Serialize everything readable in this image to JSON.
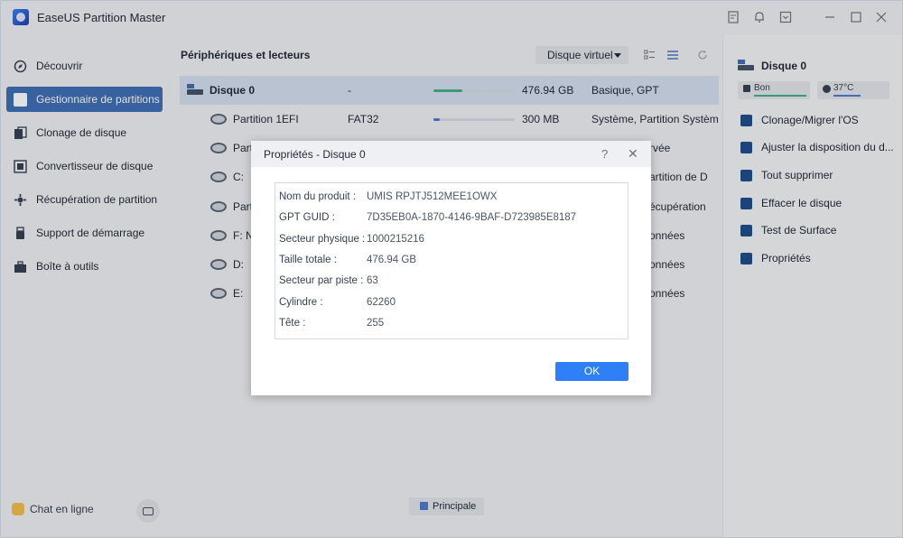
{
  "app": {
    "title": "EaseUS Partition Master"
  },
  "titlebar_icons": [
    "notes-icon",
    "bell-icon",
    "dropdown-box-icon",
    "minimize-icon",
    "maximize-icon",
    "close-icon"
  ],
  "sidebar": {
    "items": [
      {
        "label": "Découvrir",
        "icon": "compass-icon",
        "active": false
      },
      {
        "label": "Gestionnaire de partitions",
        "icon": "partition-manager-icon",
        "active": true
      },
      {
        "label": "Clonage de disque",
        "icon": "clone-icon",
        "active": false
      },
      {
        "label": "Convertisseur de disque",
        "icon": "convert-icon",
        "active": false
      },
      {
        "label": "Récupération de partition",
        "icon": "recovery-icon",
        "active": false
      },
      {
        "label": "Support de démarrage",
        "icon": "usb-icon",
        "active": false
      },
      {
        "label": "Boîte à outils",
        "icon": "toolbox-icon",
        "active": false
      }
    ],
    "chat_label": "Chat en ligne"
  },
  "main": {
    "title": "Périphériques et lecteurs",
    "virtual_disk_label": "Disque virtuel",
    "rows": [
      {
        "name": "Disque 0",
        "fs": "-",
        "size": "476.94 GB",
        "type": "Basique, GPT",
        "usage": 0.35,
        "kind": "disk"
      },
      {
        "name": "Partition 1EFI",
        "fs": "FAT32",
        "size": "300 MB",
        "type": "Système, Partition Système",
        "usage": 0.08,
        "kind": "part"
      },
      {
        "name": "Parti",
        "fs": "",
        "size": "",
        "type": "rvée",
        "usage": null,
        "kind": "part"
      },
      {
        "name": "C:",
        "fs": "",
        "size": "",
        "type": "artition de D",
        "usage": null,
        "kind": "part"
      },
      {
        "name": "Parti",
        "fs": "",
        "size": "",
        "type": "écupération",
        "usage": null,
        "kind": "part"
      },
      {
        "name": "F: Ne",
        "fs": "",
        "size": "",
        "type": "onnées",
        "usage": null,
        "kind": "part"
      },
      {
        "name": "D:",
        "fs": "",
        "size": "",
        "type": "onnées",
        "usage": null,
        "kind": "part"
      },
      {
        "name": "E:",
        "fs": "",
        "size": "",
        "type": "onnées",
        "usage": null,
        "kind": "part"
      }
    ],
    "legend_label": "Principale"
  },
  "right_panel": {
    "disk_name": "Disque 0",
    "health_label": "Bon",
    "temp_label": "37°C",
    "actions": [
      {
        "label": "Clonage/Migrer l'OS",
        "icon": "windows-icon"
      },
      {
        "label": "Ajuster la disposition du d...",
        "icon": "layout-icon"
      },
      {
        "label": "Tout supprimer",
        "icon": "trash-icon"
      },
      {
        "label": "Effacer le disque",
        "icon": "eraser-icon"
      },
      {
        "label": "Test de Surface",
        "icon": "surface-test-icon"
      },
      {
        "label": "Propriétés",
        "icon": "properties-icon"
      }
    ]
  },
  "dialog": {
    "title": "Propriétés - Disque 0",
    "help": "?",
    "close": "✕",
    "properties": [
      {
        "key": "Nom du produit :",
        "value": "UMIS RPJTJ512MEE1OWX"
      },
      {
        "key": "GPT GUID :",
        "value": "7D35EB0A-1870-4146-9BAF-D723985E8187"
      },
      {
        "key": "Secteur physique :",
        "value": "1000215216"
      },
      {
        "key": "Taille totale :",
        "value": "476.94 GB"
      },
      {
        "key": "Secteur par piste :",
        "value": "63"
      },
      {
        "key": "Cylindre :",
        "value": "62260"
      },
      {
        "key": "Tête :",
        "value": "255"
      }
    ],
    "ok_label": "OK"
  },
  "colors": {
    "accent": "#3f6fb5",
    "ok_button": "#2f7ff7",
    "disk_usage": "#43b08a",
    "part_usage": "#4a7bd0",
    "health": "#43b08a",
    "temp": "#4a7bd0"
  }
}
